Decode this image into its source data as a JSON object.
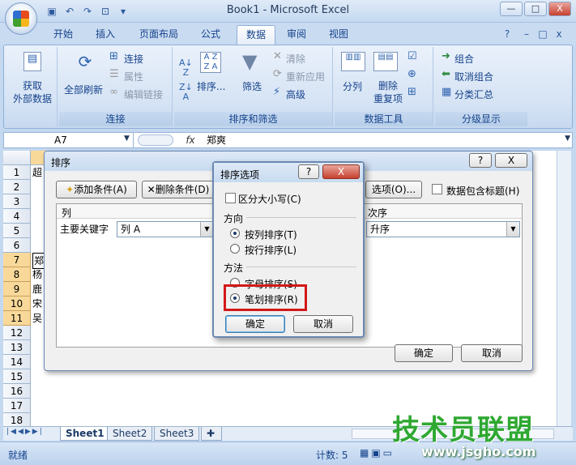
{
  "window": {
    "title": "Book1 - Microsoft Excel",
    "min": "—",
    "max": "□",
    "close": "X"
  },
  "ribbon_tabs": [
    "开始",
    "插入",
    "页面布局",
    "公式",
    "数据",
    "审阅",
    "视图"
  ],
  "groups": {
    "get_external": "获取\n外部数据",
    "connections": {
      "label": "连接",
      "refresh_all": "全部刷新",
      "items": [
        "连接",
        "属性",
        "编辑链接"
      ]
    },
    "sort_filter": {
      "label": "排序和筛选",
      "sort": "排序...",
      "filter": "筛选",
      "items": [
        "清除",
        "重新应用",
        "高级"
      ]
    },
    "data_tools": {
      "label": "数据工具",
      "split": "分列",
      "remove_dup": "删除\n重复项"
    },
    "outline": {
      "label": "分级显示",
      "items": [
        "组合",
        "取消组合",
        "分类汇总"
      ]
    }
  },
  "formula_bar": {
    "name_box": "A7",
    "fx": "fx",
    "value": "郑爽"
  },
  "rows": [
    "1",
    "2",
    "3",
    "4",
    "5",
    "6",
    "7",
    "8",
    "9",
    "10",
    "11",
    "12",
    "13",
    "14",
    "15",
    "16",
    "17",
    "18"
  ],
  "cells": {
    "r1": "超",
    "r7": "郑",
    "r8": "杨",
    "r9": "鹿",
    "r10": "宋",
    "r11": "吴"
  },
  "sheet_tabs": [
    "Sheet1",
    "Sheet2",
    "Sheet3"
  ],
  "status": {
    "ready": "就绪",
    "count": "计数: 5"
  },
  "sort_dialog": {
    "title": "排序",
    "help": "?",
    "close": "X",
    "add_level": "添加条件(A)",
    "delete_level": "删除条件(D)",
    "options": "选项(O)...",
    "has_headers": "数据包含标题(H)",
    "col_header": "列",
    "order_header": "次序",
    "primary_key": "主要关键字",
    "primary_value": "列 A",
    "order_value": "升序",
    "ok": "确定",
    "cancel": "取消"
  },
  "options_dialog": {
    "title": "排序选项",
    "help": "?",
    "close": "X",
    "case_sensitive": "区分大小写(C)",
    "orientation": "方向",
    "by_column": "按列排序(T)",
    "by_row": "按行排序(L)",
    "method": "方法",
    "by_letter": "字母排序(S)",
    "by_stroke": "笔划排序(R)",
    "ok": "确定",
    "cancel": "取消"
  },
  "watermark": {
    "brand": "技术员联盟",
    "url": "www.jsgho.com"
  }
}
